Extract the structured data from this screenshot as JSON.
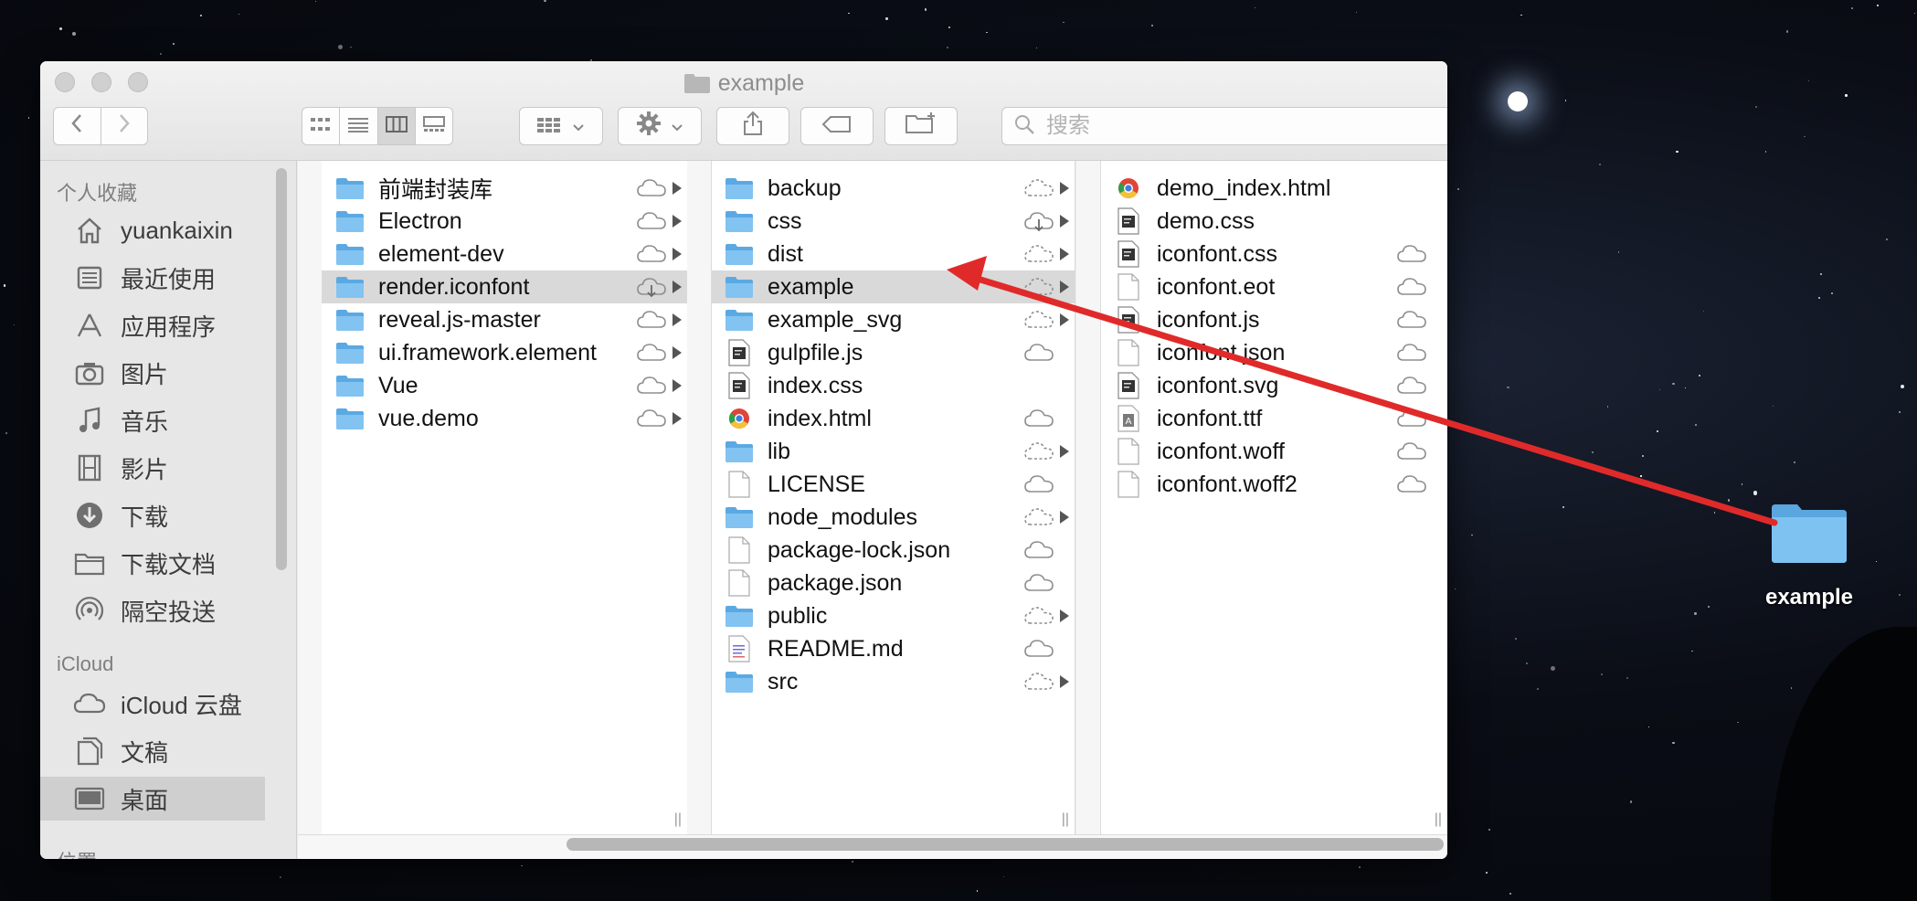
{
  "window": {
    "title": "example",
    "search_placeholder": "搜索"
  },
  "toolbar": {
    "icons": [
      "back-icon",
      "forward-icon",
      "icon-view",
      "list-view",
      "column-view",
      "gallery-view",
      "group-icon",
      "gear-icon",
      "share-icon",
      "tag-icon",
      "new-folder-icon"
    ]
  },
  "sidebar": {
    "favorites_header": "个人收藏",
    "icloud_header": "iCloud",
    "locations_header": "位置",
    "favorites": [
      {
        "label": "yuankaixin",
        "icon": "home-icon"
      },
      {
        "label": "最近使用",
        "icon": "recents-icon"
      },
      {
        "label": "应用程序",
        "icon": "applications-icon"
      },
      {
        "label": "图片",
        "icon": "camera-icon"
      },
      {
        "label": "音乐",
        "icon": "music-icon"
      },
      {
        "label": "影片",
        "icon": "film-icon"
      },
      {
        "label": "下载",
        "icon": "download-icon"
      },
      {
        "label": "下载文档",
        "icon": "folder-icon"
      },
      {
        "label": "隔空投送",
        "icon": "airdrop-icon"
      }
    ],
    "icloud": [
      {
        "label": "iCloud 云盘",
        "icon": "cloud-icon"
      },
      {
        "label": "文稿",
        "icon": "documents-icon"
      },
      {
        "label": "桌面",
        "icon": "desktop-icon"
      }
    ]
  },
  "columns": [
    {
      "items": [
        {
          "name": "前端封装库",
          "type": "folder",
          "cloud": "solid",
          "arrow": true
        },
        {
          "name": "Electron",
          "type": "folder",
          "cloud": "solid",
          "arrow": true
        },
        {
          "name": "element-dev",
          "type": "folder",
          "cloud": "solid",
          "arrow": true
        },
        {
          "name": "render.iconfont",
          "type": "folder",
          "cloud": "download",
          "arrow": true,
          "selected": true
        },
        {
          "name": "reveal.js-master",
          "type": "folder",
          "cloud": "solid",
          "arrow": true
        },
        {
          "name": "ui.framework.element",
          "type": "folder",
          "cloud": "solid",
          "arrow": true
        },
        {
          "name": "Vue",
          "type": "folder",
          "cloud": "solid",
          "arrow": true
        },
        {
          "name": "vue.demo",
          "type": "folder",
          "cloud": "solid",
          "arrow": true
        }
      ]
    },
    {
      "items": [
        {
          "name": "backup",
          "type": "folder",
          "cloud": "dashed",
          "arrow": true
        },
        {
          "name": "css",
          "type": "folder",
          "cloud": "download",
          "arrow": true
        },
        {
          "name": "dist",
          "type": "folder",
          "cloud": "dashed",
          "arrow": true
        },
        {
          "name": "example",
          "type": "folder",
          "cloud": "dashed",
          "arrow": true,
          "selected": true
        },
        {
          "name": "example_svg",
          "type": "folder",
          "cloud": "dashed",
          "arrow": true
        },
        {
          "name": "gulpfile.js",
          "type": "code",
          "cloud": "solid",
          "arrow": false
        },
        {
          "name": "index.css",
          "type": "code",
          "cloud": "none",
          "arrow": false
        },
        {
          "name": "index.html",
          "type": "chrome",
          "cloud": "solid",
          "arrow": false
        },
        {
          "name": "lib",
          "type": "folder",
          "cloud": "dashed",
          "arrow": true
        },
        {
          "name": "LICENSE",
          "type": "doc",
          "cloud": "solid",
          "arrow": false
        },
        {
          "name": "node_modules",
          "type": "folder",
          "cloud": "dashed",
          "arrow": true
        },
        {
          "name": "package-lock.json",
          "type": "doc",
          "cloud": "solid",
          "arrow": false
        },
        {
          "name": "package.json",
          "type": "doc",
          "cloud": "solid",
          "arrow": false
        },
        {
          "name": "public",
          "type": "folder",
          "cloud": "dashed",
          "arrow": true
        },
        {
          "name": "README.md",
          "type": "text",
          "cloud": "solid",
          "arrow": false
        },
        {
          "name": "src",
          "type": "folder",
          "cloud": "dashed",
          "arrow": true
        }
      ]
    },
    {
      "items": [
        {
          "name": "demo_index.html",
          "type": "chrome",
          "cloud": "none",
          "arrow": false
        },
        {
          "name": "demo.css",
          "type": "code",
          "cloud": "none",
          "arrow": false
        },
        {
          "name": "iconfont.css",
          "type": "code",
          "cloud": "solid",
          "arrow": false
        },
        {
          "name": "iconfont.eot",
          "type": "doc",
          "cloud": "solid",
          "arrow": false
        },
        {
          "name": "iconfont.js",
          "type": "code",
          "cloud": "solid",
          "arrow": false
        },
        {
          "name": "iconfont.json",
          "type": "doc",
          "cloud": "solid",
          "arrow": false
        },
        {
          "name": "iconfont.svg",
          "type": "code",
          "cloud": "solid",
          "arrow": false
        },
        {
          "name": "iconfont.ttf",
          "type": "font",
          "cloud": "solid",
          "arrow": false
        },
        {
          "name": "iconfont.woff",
          "type": "doc",
          "cloud": "solid",
          "arrow": false
        },
        {
          "name": "iconfont.woff2",
          "type": "doc",
          "cloud": "solid",
          "arrow": false
        }
      ]
    }
  ],
  "desktop": {
    "folder_label": "example"
  },
  "colors": {
    "annotation_arrow": "#e02a2a",
    "folder": "#6cb6ec",
    "selection": "#d9d9d9"
  }
}
